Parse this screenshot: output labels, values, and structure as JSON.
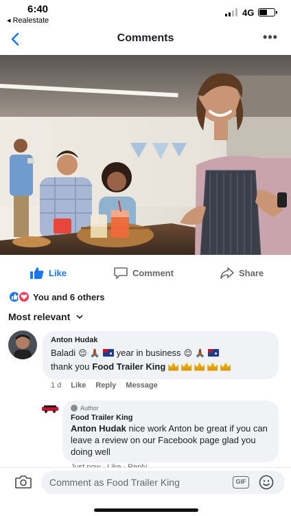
{
  "status_bar": {
    "time": "6:40",
    "back_app": "◂ Realestate",
    "network": "4G"
  },
  "header": {
    "title": "Comments",
    "more_label": "•••"
  },
  "photo": {
    "description_icon": "food-trailer-photo"
  },
  "actions": {
    "like": "Like",
    "comment": "Comment",
    "share": "Share"
  },
  "reactions": {
    "summary": "You and 6 others"
  },
  "sort": {
    "label": "Most relevant"
  },
  "comment": {
    "author": "Anton Hudak",
    "line1_a": "Baladi",
    "line1_b": "year in business",
    "line2_a": "thank you",
    "line2_b": "Food Trailer King",
    "time": "1 d",
    "like": "Like",
    "reply": "Reply",
    "message": "Message"
  },
  "reply": {
    "badge": "Author",
    "author": "Food Trailer King",
    "mention": "Anton Hudak",
    "text": "nice work Anton be great if you can leave a review on our Facebook page glad you doing well",
    "meta_partial": "Just now · Like · Reply"
  },
  "composer": {
    "placeholder": "Comment as Food Trailer King",
    "gif_label": "GIF"
  },
  "colors": {
    "accent": "#1877f2",
    "bubble": "#f0f2f5",
    "secondary_text": "#65676b"
  }
}
